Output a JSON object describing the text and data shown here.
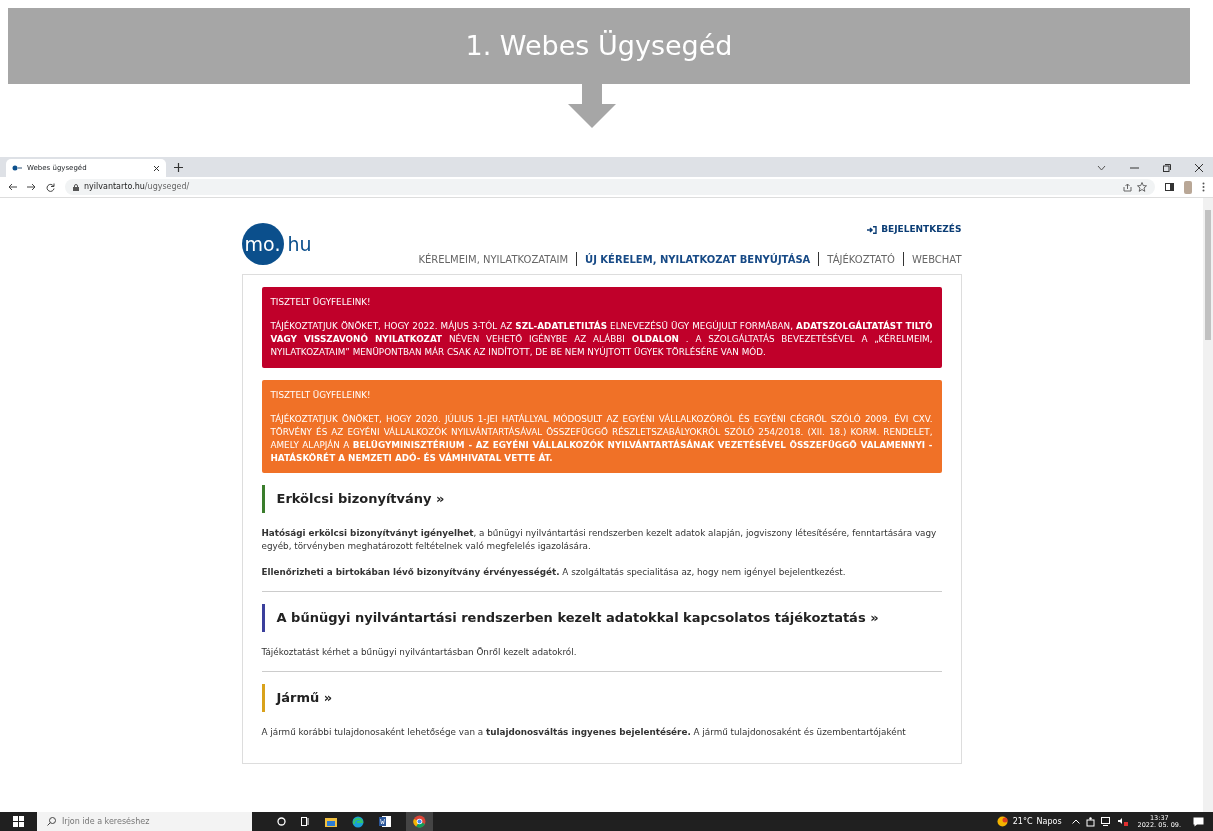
{
  "slide_title": "1. Webes Ügysegéd",
  "browser": {
    "tab_title": "Webes ügysegéd",
    "url_host": "nyilvantarto.hu",
    "url_path": "/ugyseged/"
  },
  "page": {
    "logo_main": "mo.",
    "logo_suffix": "hu",
    "login": "BEJELENTKEZÉS",
    "nav": [
      {
        "label": "KÉRELMEIM, NYILATKOZATAIM",
        "selected": false
      },
      {
        "label": "ÚJ KÉRELEM, NYILATKOZAT BENYÚJTÁSA",
        "selected": true
      },
      {
        "label": "TÁJÉKOZTATÓ",
        "selected": false
      },
      {
        "label": "WEBCHAT",
        "selected": false
      }
    ],
    "notices": [
      {
        "kind": "danger",
        "heading": "TISZTELT ÜGYFELEINK!",
        "body": "TÁJÉKOZTATJUK ÖNÖKET, HOGY 2022. MÁJUS 3-TÓL AZ **SZL-ADATLETILTÁS** ELNEVEZÉSŰ ÜGY MEGÚJULT FORMÁBAN, **ADATSZOLGÁLTATÁST TILTÓ VAGY VISSZAVONÓ NYILATKOZAT** NÉVEN VEHETŐ IGÉNYBE AZ ALÁBBI **OLDALON** . A SZOLGÁLTATÁS BEVEZETÉSÉVEL A „KÉRELMEIM, NYILATKOZATAIM” MENÜPONTBAN MÁR CSAK AZ INDÍTOTT, DE BE NEM NYÚJTOTT ÜGYEK TÖRLÉSÉRE VAN MÓD."
      },
      {
        "kind": "warning",
        "heading": "TISZTELT ÜGYFELEINK!",
        "body": "TÁJÉKOZTATJUK ÖNÖKET, HOGY 2020. JÚLIUS 1-JEI HATÁLLYAL MÓDOSULT AZ EGYÉNI VÁLLALKOZÓRÓL ÉS EGYÉNI CÉGRŐL SZÓLÓ 2009. ÉVI CXV. TÖRVÉNY ÉS AZ EGYÉNI VÁLLALKOZÓK NYILVÁNTARTÁSÁVAL ÖSSZEFÜGGŐ RÉSZLETSZABÁLYOKRÓL SZÓLÓ 254/2018. (XII. 18.) KORM. RENDELET, AMELY ALAPJÁN A **BELÜGYMINISZTÉRIUM - AZ EGYÉNI VÁLLALKOZÓK NYILVÁNTARTÁSÁNAK VEZETÉSÉVEL ÖSSZEFÜGGŐ VALAMENNYI - HATÁSKÖRÉT A NEMZETI ADÓ- ÉS VÁMHIVATAL VETTE ÁT.**"
      }
    ],
    "services": [
      {
        "title": "Erkölcsi bizonyítvány »",
        "color": "#3a7d2c",
        "paragraphs": [
          "**Hatósági erkölcsi bizonyítványt igényelhet**, a bűnügyi nyilvántartási rendszerben kezelt adatok alapján, jogviszony létesítésére, fenntartására vagy egyéb, törvényben meghatározott feltételnek való megfelelés igazolására.",
          "**Ellenőrizheti a birtokában lévő bizonyítvány érvényességét.** A szolgáltatás specialitása az, hogy nem igényel bejelentkezést."
        ]
      },
      {
        "title": "A bűnügyi nyilvántartási rendszerben kezelt adatokkal kapcsolatos tájékoztatás »",
        "color": "#3b3f9c",
        "paragraphs": [
          "Tájékoztatást kérhet a bűnügyi nyilvántartásban Önről kezelt adatokról."
        ]
      },
      {
        "title": "Jármű »",
        "color": "#d9a21b",
        "paragraphs": [
          "A jármű korábbi tulajdonosaként lehetősége van a **tulajdonosváltás ingyenes bejelentésére.** A jármű tulajdonosaként és üzembentartójaként"
        ]
      }
    ]
  },
  "taskbar": {
    "search_placeholder": "Írjon ide a kereséshez",
    "temperature": "21°C",
    "weather": "Napos",
    "time": "13:37",
    "date": "2022. 05. 09."
  }
}
